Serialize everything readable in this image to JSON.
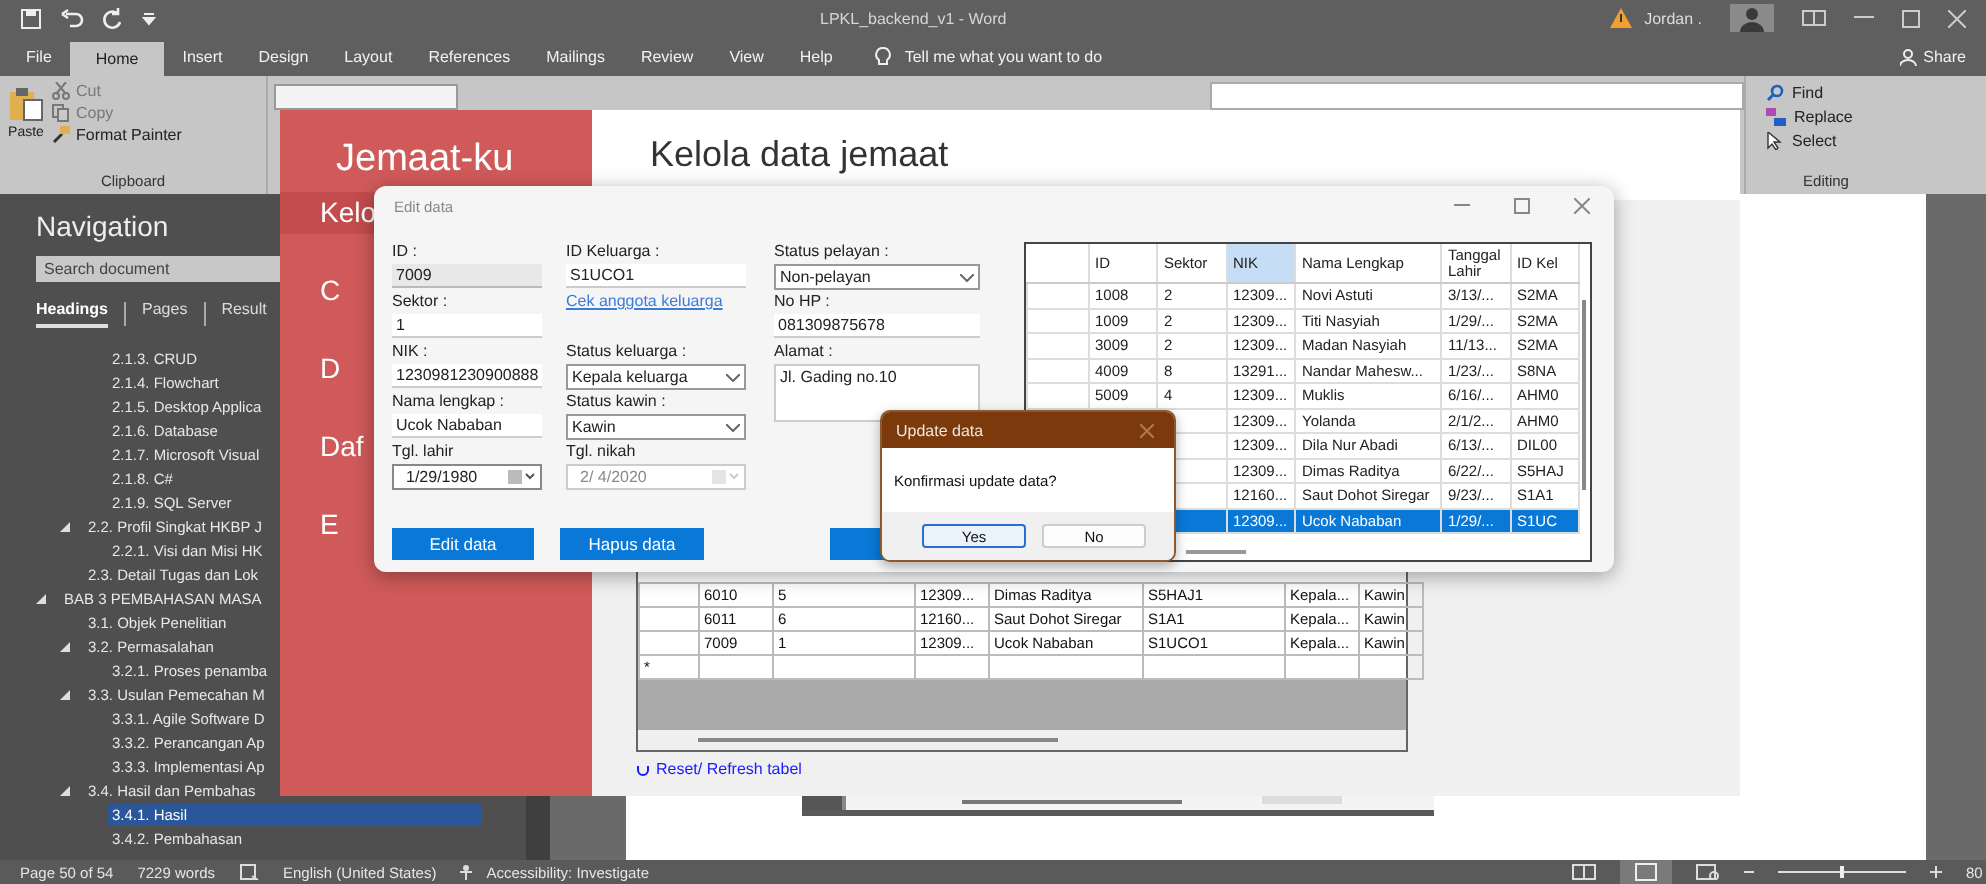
{
  "word": {
    "title": "LPKL_backend_v1  -  Word",
    "user": "Jordan .",
    "tabs": [
      {
        "label": "File",
        "selected": false
      },
      {
        "label": "Home",
        "selected": true
      },
      {
        "label": "Insert",
        "selected": false
      },
      {
        "label": "Design",
        "selected": false
      },
      {
        "label": "Layout",
        "selected": false
      },
      {
        "label": "References",
        "selected": false
      },
      {
        "label": "Mailings",
        "selected": false
      },
      {
        "label": "Review",
        "selected": false
      },
      {
        "label": "View",
        "selected": false
      },
      {
        "label": "Help",
        "selected": false
      }
    ],
    "tell_me": "Tell me what you want to do",
    "share": "Share",
    "ribbon": {
      "clipboard": {
        "paste": "Paste",
        "label": "Clipboard",
        "items": [
          {
            "label": "Cut",
            "kind": "cut",
            "disabled": true
          },
          {
            "label": "Copy",
            "kind": "copy",
            "disabled": true
          },
          {
            "label": "Format Painter",
            "kind": "painter",
            "disabled": false
          }
        ]
      },
      "editing": {
        "label": "Editing",
        "items": [
          {
            "label": "Find",
            "kind": "find"
          },
          {
            "label": "Replace",
            "kind": "replace"
          },
          {
            "label": "Select",
            "kind": "select"
          }
        ]
      }
    },
    "navigation": {
      "title": "Navigation",
      "search": {
        "placeholder": "Search document"
      },
      "tabs": [
        {
          "label": "Headings",
          "selected": true
        },
        {
          "label": "Pages",
          "selected": false
        },
        {
          "label": "Result",
          "selected": false
        }
      ],
      "tree": [
        {
          "children": [
            {
              "children": [
                {
                  "label": "2.1.3. CRUD",
                  "selected": false
                },
                {
                  "label": "2.1.4. Flowchart",
                  "selected": false
                },
                {
                  "label": "2.1.5. Desktop Applica",
                  "selected": false
                },
                {
                  "label": "2.1.6. Database",
                  "selected": false
                },
                {
                  "label": "2.1.7. Microsoft Visual",
                  "selected": false
                },
                {
                  "label": "2.1.8. C#",
                  "selected": false
                },
                {
                  "label": "2.1.9. SQL Server",
                  "selected": false
                }
              ]
            },
            {
              "label": "2.2. Profil Singkat HKBP J",
              "selected": false,
              "expanded": true,
              "children": [
                {
                  "label": "2.2.1. Visi dan Misi HK",
                  "selected": false
                }
              ]
            },
            {
              "label": "2.3. Detail Tugas dan Lok",
              "selected": false
            }
          ]
        },
        {
          "label": "BAB 3  PEMBAHASAN MASA",
          "selected": false,
          "expanded": true,
          "children": [
            {
              "label": "3.1. Objek Penelitian",
              "selected": false
            },
            {
              "label": "3.2. Permasalahan",
              "selected": false,
              "expanded": true,
              "children": [
                {
                  "label": "3.2.1. Proses penamba",
                  "selected": false
                }
              ]
            },
            {
              "label": "3.3.  Usulan Pemecahan M",
              "selected": false,
              "expanded": true,
              "children": [
                {
                  "label": "3.3.1. Agile Software D",
                  "selected": false
                },
                {
                  "label": "3.3.2. Perancangan Ap",
                  "selected": false
                },
                {
                  "label": "3.3.3. Implementasi Ap",
                  "selected": false
                }
              ]
            },
            {
              "label": "3.4.  Hasil dan Pembahas",
              "selected": false,
              "expanded": true,
              "children": [
                {
                  "label": "3.4.1. Hasil",
                  "selected": true
                },
                {
                  "label": "3.4.2. Pembahasan",
                  "selected": false
                }
              ]
            }
          ]
        }
      ]
    },
    "status_bar": {
      "page": "Page 50 of 54",
      "words": "7229 words",
      "language": "English (United States)",
      "accessibility": "Accessibility: Investigate",
      "zoom": "80",
      "zoom_slider": {
        "level": 0.5
      }
    }
  },
  "app": {
    "title": "Jemaat-ku",
    "heading": "Kelola data jemaat",
    "sidebar": [
      {
        "label": "Kelo",
        "selected": true
      },
      {
        "label": "C",
        "selected": false
      },
      {
        "label": "D",
        "selected": false
      },
      {
        "label": "Daf",
        "selected": false
      },
      {
        "label": "E",
        "selected": false
      }
    ],
    "table": {
      "rows": [
        [
          "6010",
          "5",
          "12309...",
          "Dimas Raditya",
          "S5HAJ1",
          "Kepala...",
          "Kawin"
        ],
        [
          "6011",
          "6",
          "12160...",
          "Saut Dohot Siregar",
          "S1A1",
          "Kepala...",
          "Kawin"
        ],
        [
          "7009",
          "1",
          "12309...",
          "Ucok Nababan",
          "S1UCO1",
          "Kepala...",
          "Kawin"
        ]
      ],
      "new_row_marker": "*"
    },
    "refresh_link": "Reset/ Refresh tabel"
  },
  "edit_dialog": {
    "title": "Edit data",
    "columns": [
      [
        {
          "kind": "text",
          "label": "ID :",
          "value": "7009",
          "readonly": true
        },
        {
          "kind": "text",
          "label": "Sektor :",
          "value": "1",
          "readonly": false
        },
        {
          "kind": "text",
          "label": "NIK :",
          "value": "1230981230900888",
          "readonly": false
        },
        {
          "kind": "text",
          "label": "Nama lengkap :",
          "value": "Ucok Nababan",
          "readonly": false
        },
        {
          "kind": "date",
          "label": "Tgl. lahir",
          "value": "1/29/1980",
          "disabled": false
        }
      ],
      [
        {
          "kind": "text",
          "label": "ID Keluarga :",
          "value": "S1UCO1",
          "readonly": false
        },
        {
          "kind": "link",
          "label": "Cek anggota keluarga"
        },
        {
          "kind": "dropdown",
          "label": "Status keluarga :",
          "value": "Kepala keluarga"
        },
        {
          "kind": "dropdown",
          "label": "Status kawin :",
          "value": "Kawin"
        },
        {
          "kind": "date",
          "label": "Tgl. nikah",
          "value": "2/ 4/2020",
          "disabled": true
        }
      ],
      [
        {
          "kind": "dropdown",
          "label": "Status pelayan :",
          "value": "Non-pelayan"
        },
        {
          "kind": "text",
          "label": "No HP :",
          "value": "081309875678",
          "readonly": false
        },
        {
          "kind": "textarea",
          "label": "Alamat :",
          "value": "Jl. Gading no.10"
        }
      ]
    ],
    "buttons": [
      {
        "label": "Edit data"
      },
      {
        "label": "Hapus data"
      }
    ],
    "grid": {
      "columns": [
        {
          "label": "ID",
          "selected": false
        },
        {
          "label": "Sektor",
          "selected": false
        },
        {
          "label": "NIK",
          "selected": true
        },
        {
          "label": "Nama Lengkap",
          "selected": false
        },
        {
          "label": "Tanggal Lahir",
          "selected": false
        },
        {
          "label": "ID Kel",
          "selected": false
        }
      ],
      "rows": [
        {
          "selected": false,
          "cells": [
            "1008",
            "2",
            "12309...",
            "Novi Astuti",
            "3/13/...",
            "S2MA"
          ]
        },
        {
          "selected": false,
          "cells": [
            "1009",
            "2",
            "12309...",
            "Titi Nasyiah",
            "1/29/...",
            "S2MA"
          ]
        },
        {
          "selected": false,
          "cells": [
            "3009",
            "2",
            "12309...",
            "Madan Nasyiah",
            "11/13...",
            "S2MA"
          ]
        },
        {
          "selected": false,
          "cells": [
            "4009",
            "8",
            "13291...",
            "Nandar Mahesw...",
            "1/23/...",
            "S8NA"
          ]
        },
        {
          "selected": false,
          "cells": [
            "5009",
            "4",
            "12309...",
            "Muklis",
            "6/16/...",
            "AHM0"
          ]
        },
        {
          "selected": false,
          "cells": [
            null,
            null,
            "12309...",
            "Yolanda",
            "2/1/2...",
            "AHM0"
          ]
        },
        {
          "selected": false,
          "cells": [
            null,
            null,
            "12309...",
            "Dila Nur Abadi",
            "6/13/...",
            "DIL00"
          ]
        },
        {
          "selected": false,
          "cells": [
            null,
            null,
            "12309...",
            "Dimas Raditya",
            "6/22/...",
            "S5HAJ"
          ]
        },
        {
          "selected": false,
          "cells": [
            null,
            null,
            "12160...",
            "Saut Dohot Siregar",
            "9/23/...",
            "S1A1"
          ]
        },
        {
          "selected": true,
          "cells": [
            null,
            null,
            "12309...",
            "Ucok Nababan",
            "1/29/...",
            "S1UC"
          ]
        }
      ]
    }
  },
  "message_box": {
    "title": "Update data",
    "message": "Konfirmasi update data?",
    "buttons": [
      {
        "label": "Yes",
        "focused": true
      },
      {
        "label": "No",
        "focused": false
      }
    ]
  }
}
